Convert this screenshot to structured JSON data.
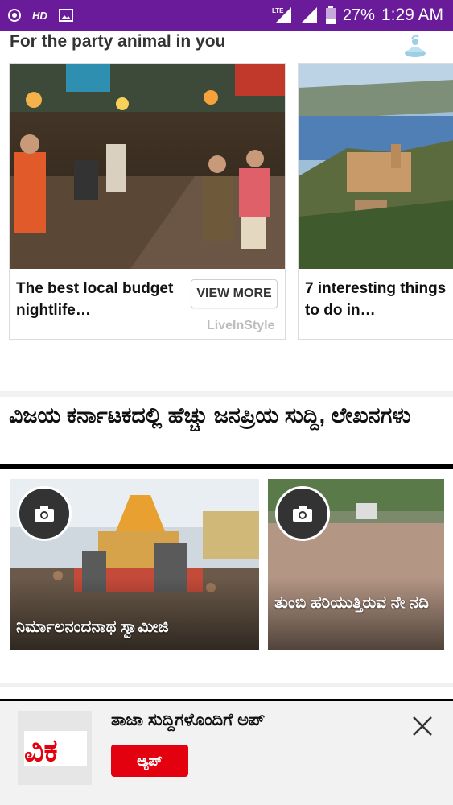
{
  "status_bar": {
    "hd": "HD",
    "lte": "LTE",
    "battery": "27%",
    "time": "1:29 AM",
    "background": "#6a1b9a"
  },
  "section_party": {
    "title": "For the party animal in you",
    "cards": [
      {
        "title": "The best local budget nightlife…",
        "button": "VIEW MORE",
        "brand": "LiveInStyle"
      },
      {
        "title": "7 interesting things to do in…"
      }
    ]
  },
  "section_popular": {
    "title": "ವಿಜಯ ಕರ್ನಾಟಕದಲ್ಲಿ ಹೆಚ್ಚು ಜನಪ್ರಿಯ ಸುದ್ದಿ, ಲೇಖನಗಳು",
    "photos": [
      {
        "caption": "ನಿರ್ಮಾಲನಂದನಾಥ ಸ್ವಾಮೀಜಿ",
        "icon": "camera-icon"
      },
      {
        "caption": "ತುಂಬಿ ಹರಿಯುತ್ತಿರುವ ನೇ ನದಿ",
        "icon": "camera-icon"
      }
    ]
  },
  "banner": {
    "text": "ತಾಜಾ ಸುದ್ದಿಗಳೊಂದಿಗೆ ಅಪ್",
    "button": "ಆ್ಯಪ್",
    "logo_text": "ವಿಕ",
    "accent": "#e3000f"
  }
}
